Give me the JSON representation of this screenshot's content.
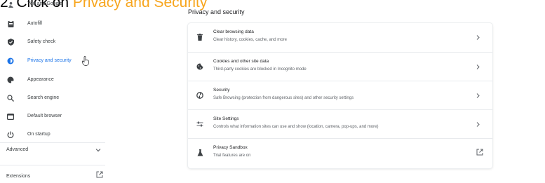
{
  "banner": {
    "step": "2.",
    "prefix": "Click on",
    "highlight": "Privacy and Security"
  },
  "sidebar": {
    "items": [
      {
        "label": "You and Google",
        "icon": "person-icon"
      },
      {
        "label": "Autofill",
        "icon": "clipboard-icon"
      },
      {
        "label": "Safety check",
        "icon": "shield-check-icon"
      },
      {
        "label": "Privacy and security",
        "icon": "shield-icon",
        "active": true
      },
      {
        "label": "Appearance",
        "icon": "palette-icon"
      },
      {
        "label": "Search engine",
        "icon": "search-icon"
      },
      {
        "label": "Default browser",
        "icon": "browser-icon"
      },
      {
        "label": "On startup",
        "icon": "power-icon"
      }
    ],
    "advanced_label": "Advanced",
    "extensions_label": "Extensions"
  },
  "main": {
    "section_title": "Privacy and security",
    "rows": [
      {
        "title": "Clear browsing data",
        "description": "Clear history, cookies, cache, and more",
        "icon": "trash-icon",
        "action": "chevron-right-icon"
      },
      {
        "title": "Cookies and other site data",
        "description": "Third-party cookies are blocked in Incognito mode",
        "icon": "cookie-icon",
        "action": "chevron-right-icon"
      },
      {
        "title": "Security",
        "description": "Safe Browsing (protection from dangerous sites) and other security settings",
        "icon": "security-globe-icon",
        "action": "chevron-right-icon"
      },
      {
        "title": "Site Settings",
        "description": "Controls what information sites can use and show (location, camera, pop-ups, and more)",
        "icon": "sliders-icon",
        "action": "chevron-right-icon"
      },
      {
        "title": "Privacy Sandbox",
        "description": "Trial features are on",
        "icon": "flask-icon",
        "action": "open-external-icon"
      }
    ]
  },
  "colors": {
    "accent": "#1a73e8",
    "highlight": "#f7a51d",
    "text": "#202124",
    "secondary": "#5f6368"
  }
}
